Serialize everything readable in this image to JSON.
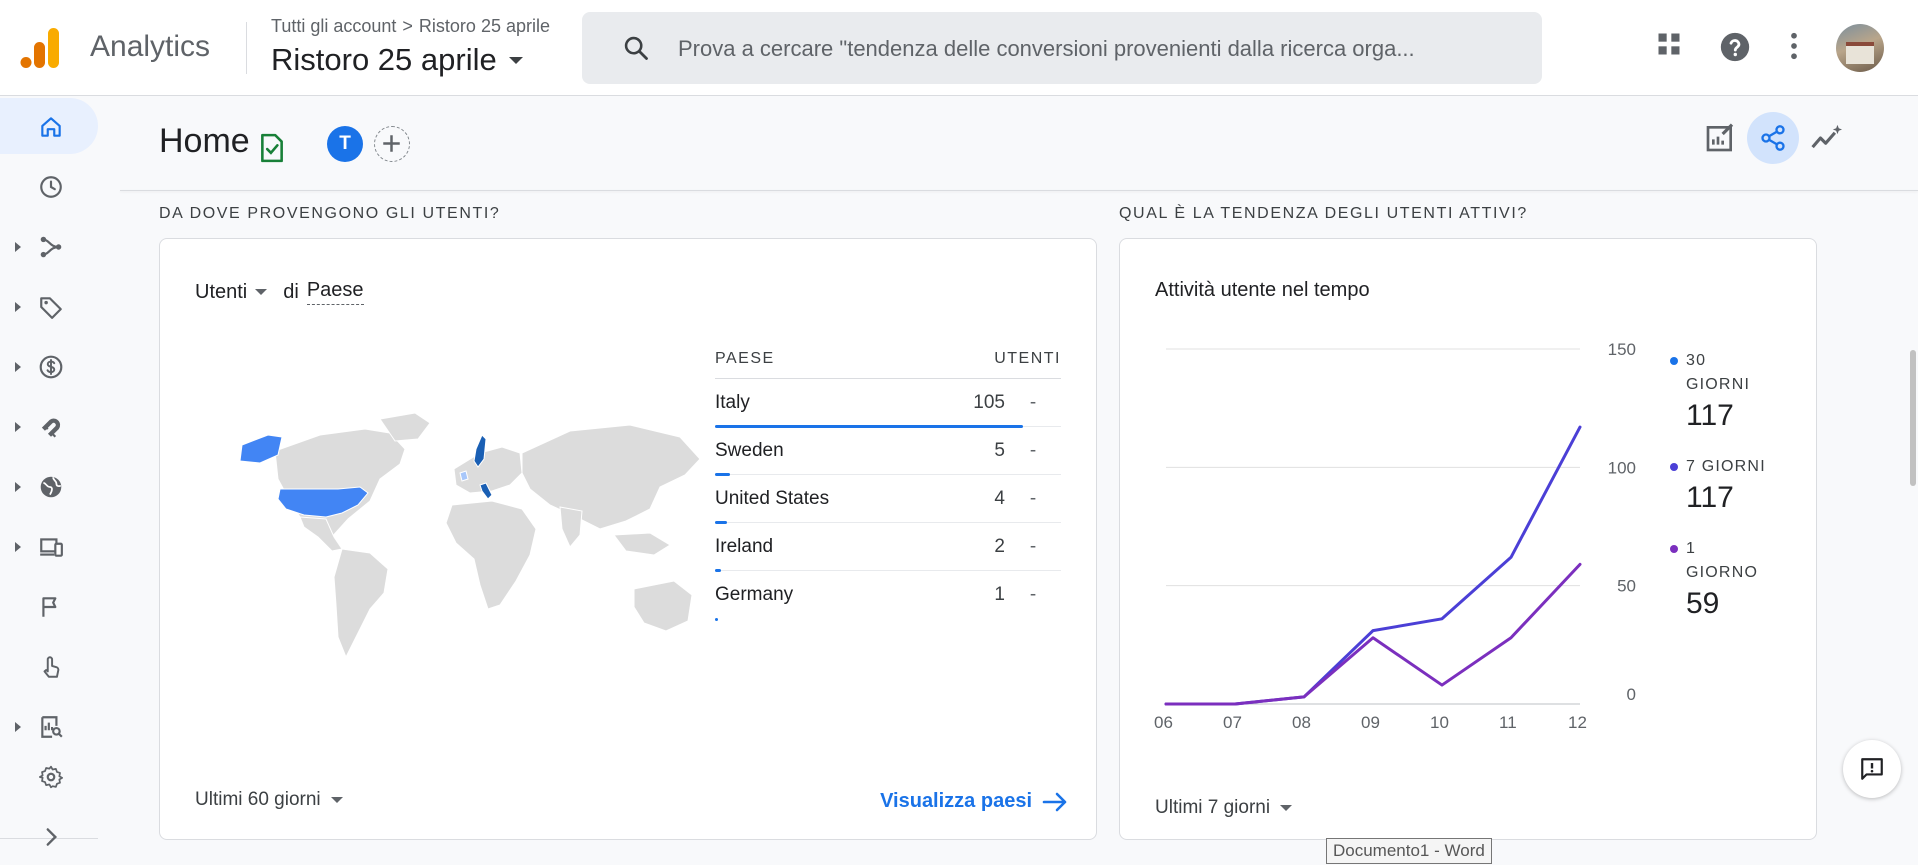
{
  "header": {
    "brand": "Analytics",
    "breadcrumb_root": "Tutti gli account",
    "breadcrumb_sep": ">",
    "breadcrumb_leaf": "Ristoro 25 aprile",
    "property": "Ristoro 25 aprile",
    "search_placeholder": "Prova a cercare \"tendenza delle conversioni provenienti dalla ricerca orga...",
    "icons": [
      "apps-grid-icon",
      "help-icon",
      "more-vert-icon"
    ],
    "colors": {
      "logo_orange_dark": "#e37400",
      "logo_orange": "#f9ab00"
    }
  },
  "sidebar": {
    "items": [
      {
        "icon": "home-icon",
        "active": true
      },
      {
        "icon": "clock-icon"
      },
      {
        "icon": "flow-icon",
        "expandable": true
      },
      {
        "icon": "tag-icon",
        "expandable": true
      },
      {
        "icon": "dollar-icon",
        "expandable": true
      },
      {
        "icon": "magnet-icon",
        "expandable": true
      },
      {
        "icon": "globe-icon",
        "expandable": true
      },
      {
        "icon": "devices-icon",
        "expandable": true
      },
      {
        "icon": "flag-icon"
      },
      {
        "icon": "touch-icon"
      },
      {
        "icon": "report-search-icon",
        "expandable": true
      },
      {
        "icon": "settings-icon"
      },
      {
        "icon": "expand-icon"
      }
    ]
  },
  "page": {
    "title": "Home",
    "user_badge": "T",
    "actions": [
      "edit-report-icon",
      "share-icon",
      "insights-icon"
    ]
  },
  "left_section": {
    "label": "DA DOVE PROVENGONO GLI UTENTI?",
    "metric": "Utenti",
    "prep": "di",
    "dimension": "Paese",
    "table_headers": {
      "country": "PAESE",
      "users": "UTENTI"
    },
    "rows": [
      {
        "country": "Italy",
        "users": "105",
        "dash": "-",
        "share": 1.0
      },
      {
        "country": "Sweden",
        "users": "5",
        "dash": "-",
        "share": 0.048
      },
      {
        "country": "United States",
        "users": "4",
        "dash": "-",
        "share": 0.038
      },
      {
        "country": "Ireland",
        "users": "2",
        "dash": "-",
        "share": 0.019
      },
      {
        "country": "Germany",
        "users": "1",
        "dash": "-",
        "share": 0.0095
      }
    ],
    "date_range": "Ultimi 60 giorni",
    "view_link": "Visualizza paesi",
    "map_colors": {
      "land": "#dcdcdc",
      "high": "#1a5fb4",
      "mid": "#4285f4",
      "low": "#a8c7fa"
    }
  },
  "right_section": {
    "label": "QUAL È LA TENDENZA DEGLI UTENTI ATTIVI?",
    "chart_title": "Attività utente nel tempo",
    "date_range": "Ultimi 7 giorni",
    "legend": [
      {
        "label": "30 GIORNI",
        "value": "117",
        "color": "#1a73e8"
      },
      {
        "label": "7 GIORNI",
        "value": "117",
        "color": "#4b3fd6"
      },
      {
        "label": "1 GIORNO",
        "value": "59",
        "color": "#7b2fbe"
      }
    ]
  },
  "chart_data": {
    "type": "line",
    "x": [
      "06 giu",
      "07",
      "08",
      "09",
      "10",
      "11",
      "12"
    ],
    "series": [
      {
        "name": "30 GIORNI",
        "values": [
          0,
          0,
          3,
          31,
          36,
          62,
          117
        ],
        "color": "#4b3fd6"
      },
      {
        "name": "1 GIORNO",
        "values": [
          0,
          0,
          3,
          28,
          8,
          28,
          59
        ],
        "color": "#7b2fbe"
      }
    ],
    "yticks": [
      0,
      50,
      100,
      150
    ],
    "ylim": [
      0,
      150
    ],
    "grid": true,
    "y_axis_side": "right"
  },
  "taskbar_tooltip": "Documento1 - Word"
}
